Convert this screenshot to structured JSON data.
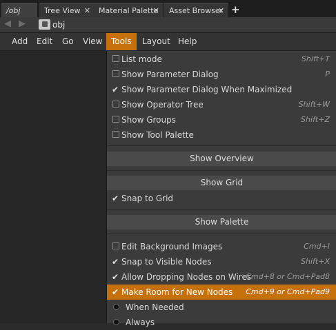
{
  "tabs": [
    {
      "label": "/obj",
      "active": true,
      "closable": false
    },
    {
      "label": "Tree View",
      "active": false,
      "closable": true
    },
    {
      "label": "Material Palette",
      "active": false,
      "closable": true
    },
    {
      "label": "Asset Browser",
      "active": false,
      "closable": true
    }
  ],
  "tab_close_glyph": "✕",
  "tab_add_glyph": "+",
  "path": {
    "back_icon": "arrow-left-icon",
    "forward_icon": "arrow-right-icon",
    "label": "obj"
  },
  "menu": [
    "Add",
    "Edit",
    "Go",
    "View",
    "Tools",
    "Layout",
    "Help"
  ],
  "active_menu": "Tools",
  "accent_color": "#c5700a",
  "dropdown": {
    "items_top": [
      {
        "label": "List mode",
        "shortcut": "Shift+T",
        "checked": false
      },
      {
        "label": "Show Parameter Dialog",
        "shortcut": "P",
        "checked": false
      },
      {
        "label": "Show Parameter Dialog When Maximized",
        "shortcut": "",
        "checked": true
      },
      {
        "label": "Show Operator Tree",
        "shortcut": "Shift+W",
        "checked": false
      },
      {
        "label": "Show Groups",
        "shortcut": "Shift+Z",
        "checked": false
      },
      {
        "label": "Show Tool Palette",
        "shortcut": "",
        "checked": false
      }
    ],
    "section_overview": "Show Overview",
    "section_grid": "Show Grid",
    "snap_grid": {
      "label": "Snap to Grid",
      "checked": true
    },
    "section_palette": "Show Palette",
    "items_bottom": [
      {
        "label": "Edit Background Images",
        "shortcut": "Cmd+I",
        "checked": false
      },
      {
        "label": "Snap to Visible Nodes",
        "shortcut": "Shift+X",
        "checked": true
      },
      {
        "label": "Allow Dropping Nodes on Wires",
        "shortcut": "Cmd+8 or Cmd+Pad8",
        "checked": true
      },
      {
        "label": "Make Room for New Nodes",
        "shortcut": "Cmd+9 or Cmd+Pad9",
        "checked": true,
        "highlighted": true
      }
    ],
    "radios": [
      "When Needed",
      "Always"
    ]
  }
}
